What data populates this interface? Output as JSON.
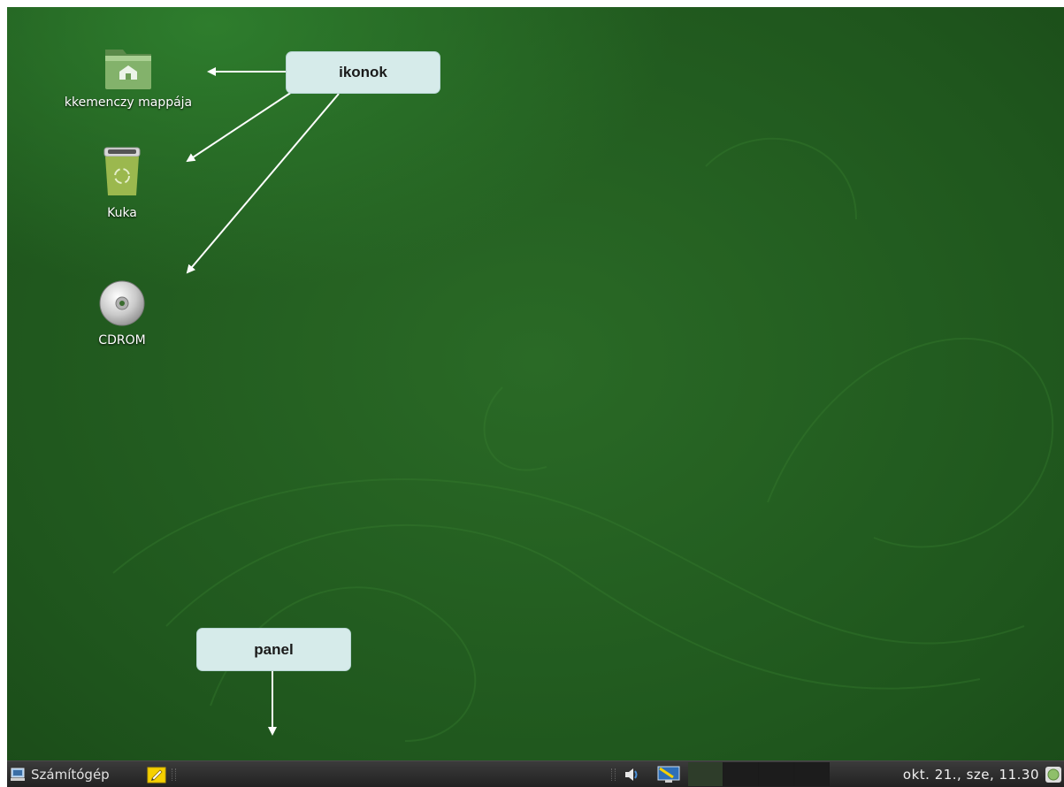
{
  "desktop": {
    "icons": [
      {
        "label": "kkemenczy mappája",
        "icon": "home-folder-icon"
      },
      {
        "label": "Kuka",
        "icon": "trash-icon"
      },
      {
        "label": "CDROM",
        "icon": "cdrom-icon"
      }
    ]
  },
  "annotations": {
    "icons_callout": "ikonok",
    "panel_callout": "panel"
  },
  "panel": {
    "menu_label": "Számítógép",
    "clock": "okt. 21., sze, 11.30",
    "workspace_count": 4,
    "active_workspace": 1
  },
  "colors": {
    "desktop": "#256622",
    "panel": "#2b2b2b",
    "callout": "#d6ebea",
    "accent": "#f5d000"
  }
}
